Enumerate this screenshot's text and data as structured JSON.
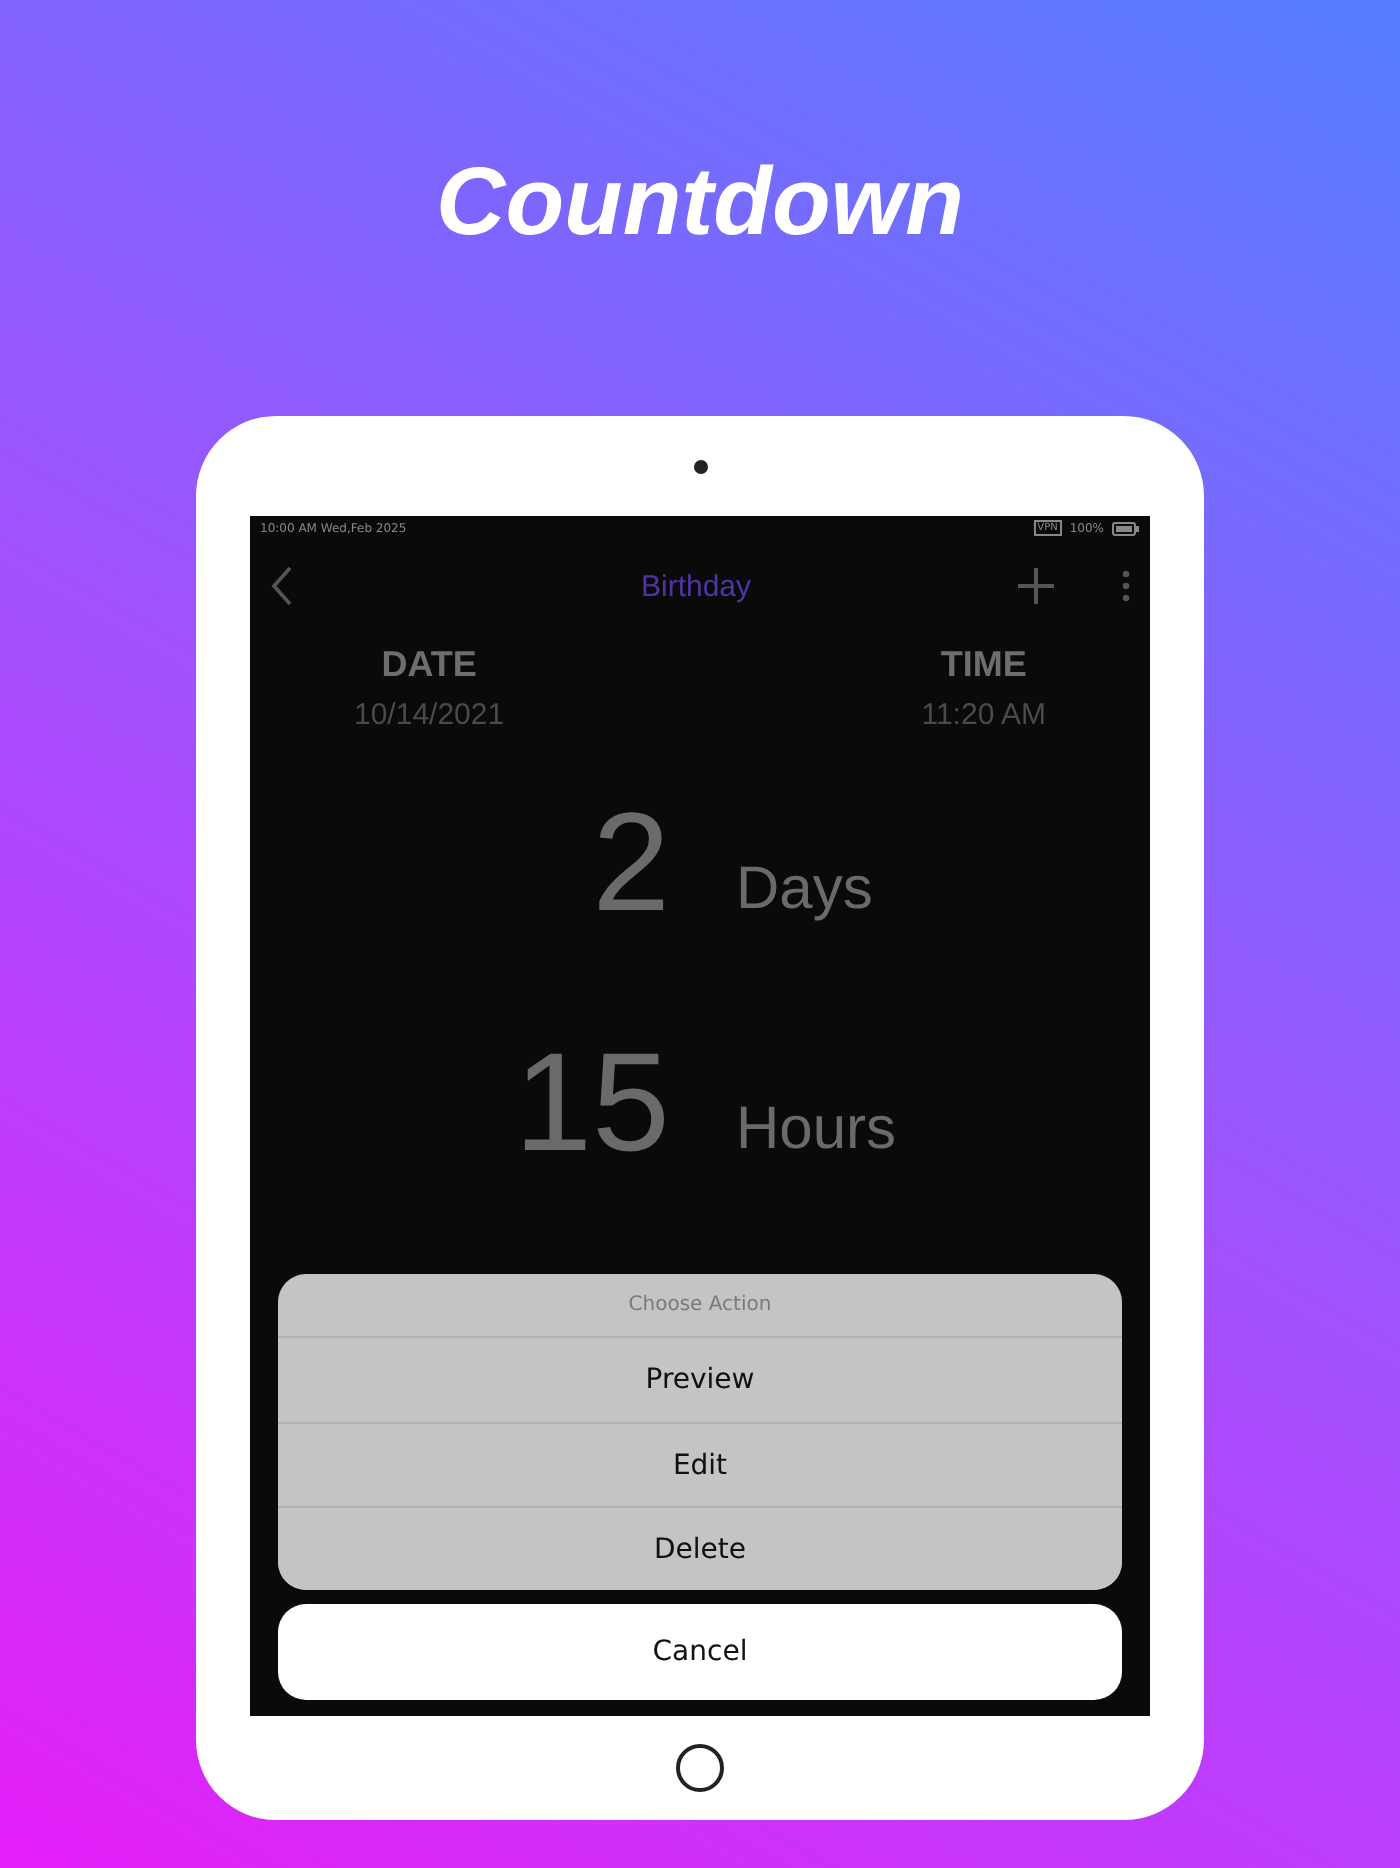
{
  "headline": "Countdown",
  "status_bar": {
    "time": "10:00 AM Wed,Feb 2025",
    "vpn": "VPN",
    "battery": "100%"
  },
  "header": {
    "title": "Birthday"
  },
  "when": [
    {
      "label": "DATE",
      "value": "10/14/2021"
    },
    {
      "label": "TIME",
      "value": "11:20 AM"
    }
  ],
  "countdown": [
    {
      "value": "2",
      "unit": "Days"
    },
    {
      "value": "15",
      "unit": "Hours"
    }
  ],
  "action_sheet": {
    "title": "Choose Action",
    "actions": [
      "Preview",
      "Edit",
      "Delete"
    ],
    "cancel": "Cancel"
  }
}
